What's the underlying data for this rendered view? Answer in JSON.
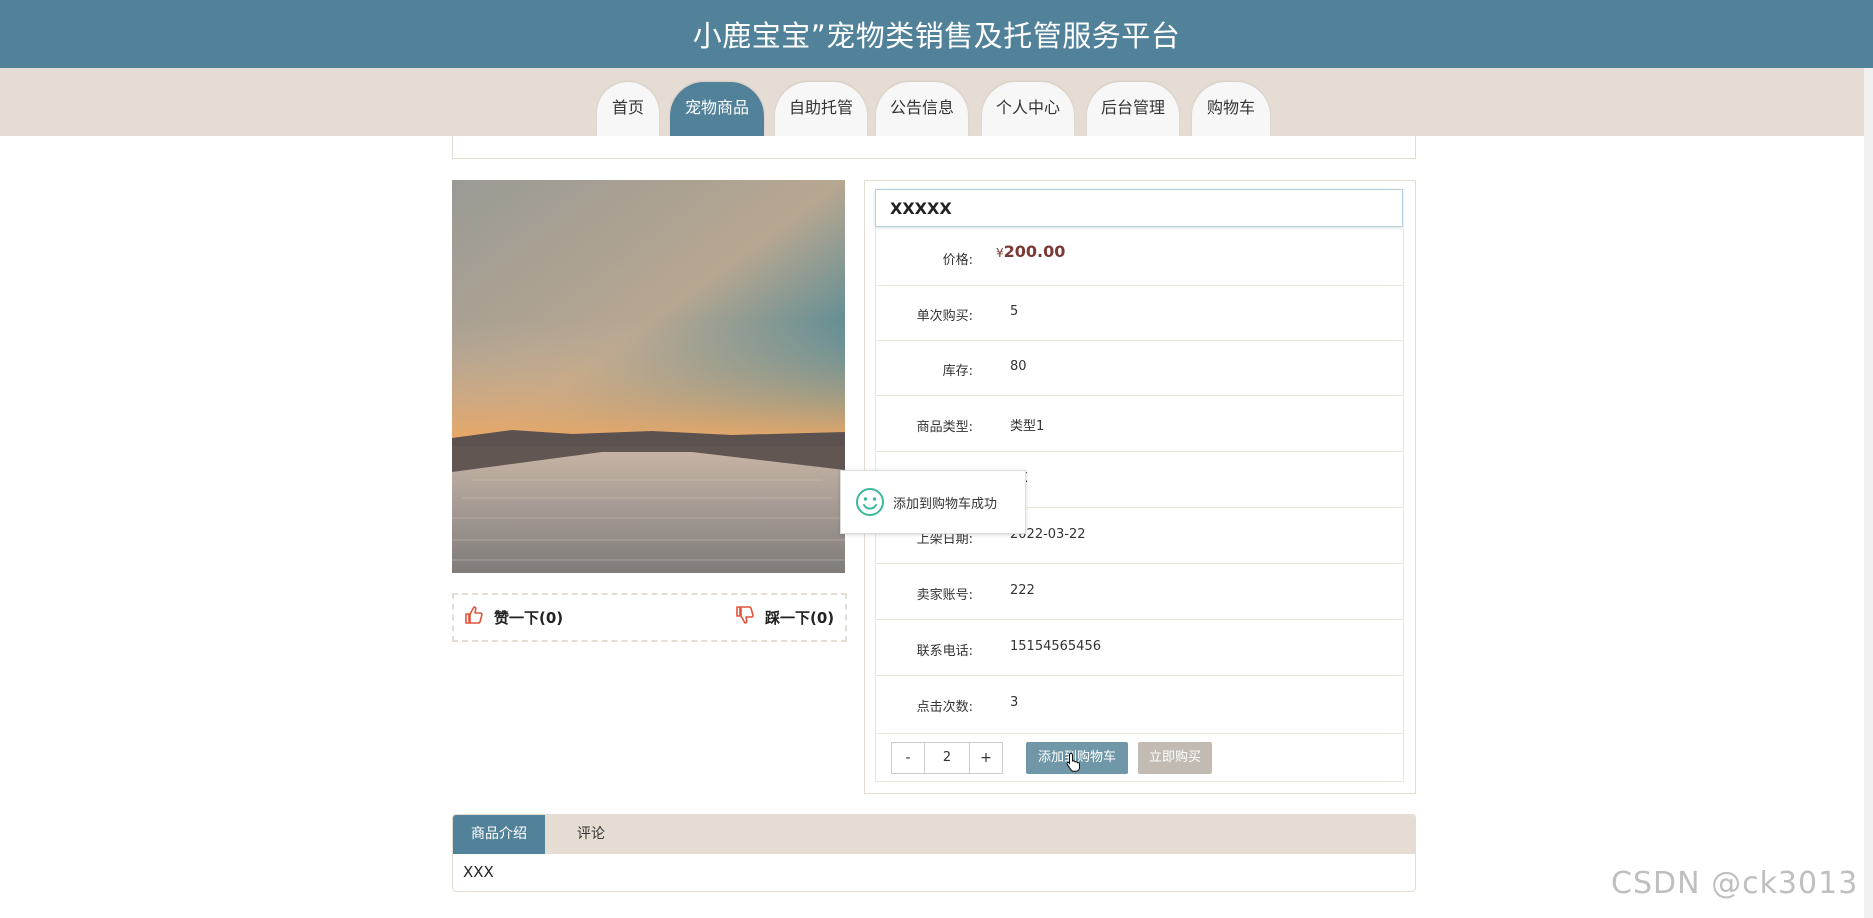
{
  "header": {
    "title": "小鹿宝宝”宠物类销售及托管服务平台"
  },
  "nav": [
    {
      "label": "首页"
    },
    {
      "label": "宠物商品"
    },
    {
      "label": "自助托管"
    },
    {
      "label": "公告信息"
    },
    {
      "label": "个人中心"
    },
    {
      "label": "后台管理"
    },
    {
      "label": "购物车"
    }
  ],
  "product": {
    "name": "XXXXX",
    "price_label": "价格:",
    "price_currency": "¥",
    "price_value": "200.00",
    "rows": [
      {
        "label": "单次购买:",
        "value": "5"
      },
      {
        "label": "库存:",
        "value": "80"
      },
      {
        "label": "商品类型:",
        "value": "类型1"
      },
      {
        "label": "",
        "value": "XX"
      },
      {
        "label": "上架日期:",
        "value": "2022-03-22"
      },
      {
        "label": "卖家账号:",
        "value": "222"
      },
      {
        "label": "联系电话:",
        "value": "15154565456"
      },
      {
        "label": "点击次数:",
        "value": "3"
      }
    ]
  },
  "votes": {
    "like": "赞一下(0)",
    "dislike": "踩一下(0)"
  },
  "quantity": {
    "minus": "-",
    "value": "2",
    "plus": "+"
  },
  "actions": {
    "add_to_cart": "添加到购物车",
    "buy_now": "立即购买"
  },
  "toast": {
    "message": "添加到购物车成功"
  },
  "tabs": [
    {
      "label": "商品介绍"
    },
    {
      "label": "评论"
    }
  ],
  "tab_content": "XXX",
  "watermark": "CSDN @ck3013",
  "colors": {
    "primary": "#528299",
    "nav_bg": "#e5ddd3",
    "price": "#7a3a36",
    "toast_icon": "#3db79d"
  }
}
